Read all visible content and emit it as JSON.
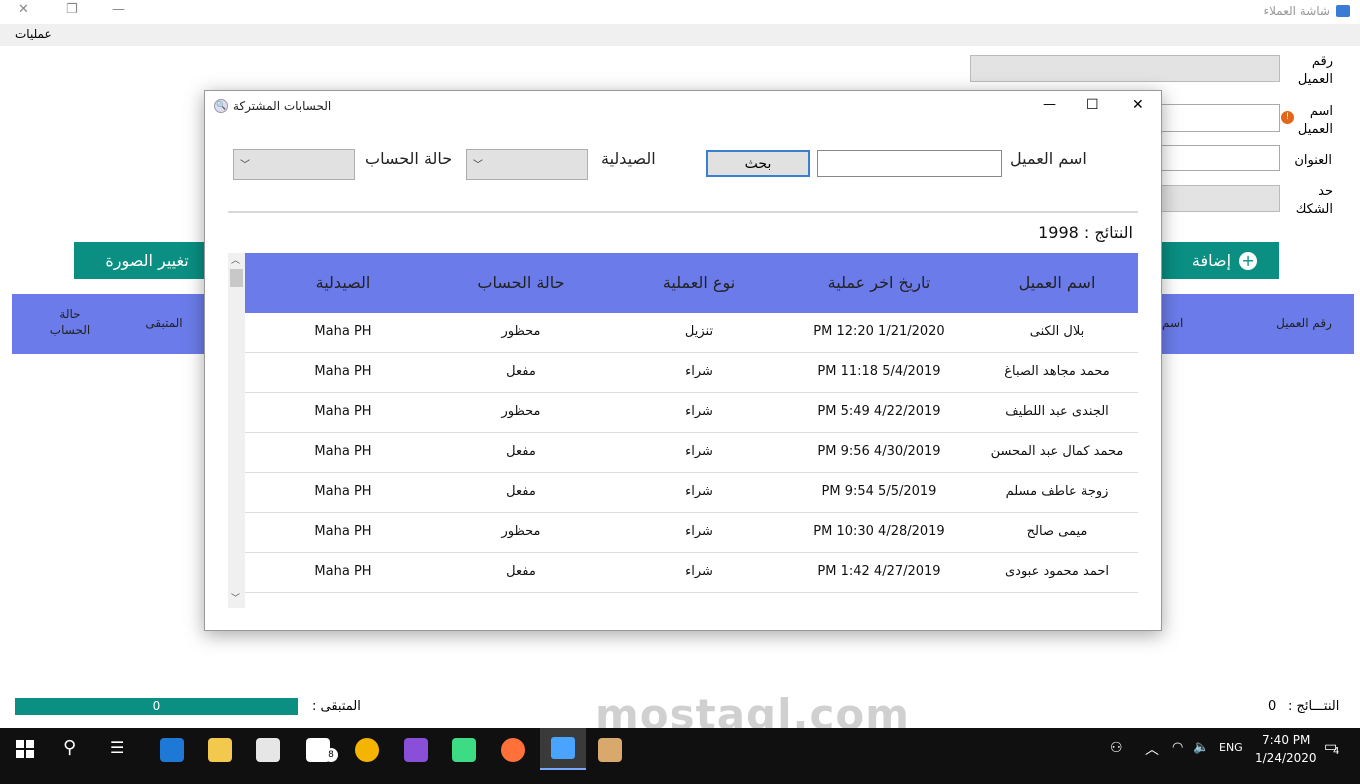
{
  "window": {
    "title": "شاشة العملاء",
    "controls": {
      "close": "✕",
      "maximize": "❐",
      "minimize": "—"
    }
  },
  "menu": {
    "items": [
      {
        "label": "عمليات"
      }
    ]
  },
  "form": {
    "labels": {
      "customer_number": "رقم العميل",
      "customer_name": "اسم العميل",
      "address": "العنوان",
      "check_limit": "حد الشكك"
    },
    "buttons": {
      "change_image": "تغيير الصورة",
      "add": "إضافة"
    }
  },
  "back_grid": {
    "columns": [
      "حالة الحساب",
      "المتبقى",
      "اسم",
      "رقم العميل"
    ]
  },
  "footer": {
    "remaining_label": "المتبقى :",
    "remaining_value": "0",
    "results_label": "النتـــائج :",
    "results_value": "0"
  },
  "dialog": {
    "title": "الحسابات المشتركة",
    "controls": {
      "minimize": "—",
      "maximize": "☐",
      "close": "✕"
    },
    "filters": {
      "customer_name_label": "اسم العميل",
      "customer_name_value": "",
      "search_button": "بحث",
      "pharmacy_label": "الصيدلية",
      "pharmacy_value": "",
      "account_status_label": "حالة الحساب",
      "account_status_value": ""
    },
    "results_text": "النتائج : 1998",
    "table": {
      "headers": [
        "اسم العميل",
        "تاريخ اخر عملية",
        "نوع العملية",
        "حالة الحساب",
        "الصيدلية"
      ],
      "rows": [
        [
          "بلال الكنى",
          "PM 12:20 1/21/2020",
          "تنزيل",
          "محظور",
          "Maha PH"
        ],
        [
          "محمد مجاهد الصباغ",
          "PM 11:18 5/4/2019",
          "شراء",
          "مفعل",
          "Maha PH"
        ],
        [
          "الجندى عبد اللطيف",
          "PM 5:49 4/22/2019",
          "شراء",
          "محظور",
          "Maha PH"
        ],
        [
          "محمد كمال عبد المحسن",
          "PM 9:56 4/30/2019",
          "شراء",
          "مفعل",
          "Maha PH"
        ],
        [
          "زوجة عاطف مسلم",
          "PM 9:54 5/5/2019",
          "شراء",
          "مفعل",
          "Maha PH"
        ],
        [
          "ميمى صالح",
          "PM 10:30 4/28/2019",
          "شراء",
          "محظور",
          "Maha PH"
        ],
        [
          "احمد محمود عبودى",
          "PM 1:42 4/27/2019",
          "شراء",
          "مفعل",
          "Maha PH"
        ]
      ]
    }
  },
  "taskbar": {
    "time": "7:40 PM",
    "date": "1/24/2020",
    "language": "ENG",
    "mail_badge": "8",
    "notification_count": "4"
  },
  "watermark": {
    "text": "mostaql.com"
  },
  "colors": {
    "accent_teal": "#0a8f82",
    "grid_header": "#6b7cea"
  }
}
